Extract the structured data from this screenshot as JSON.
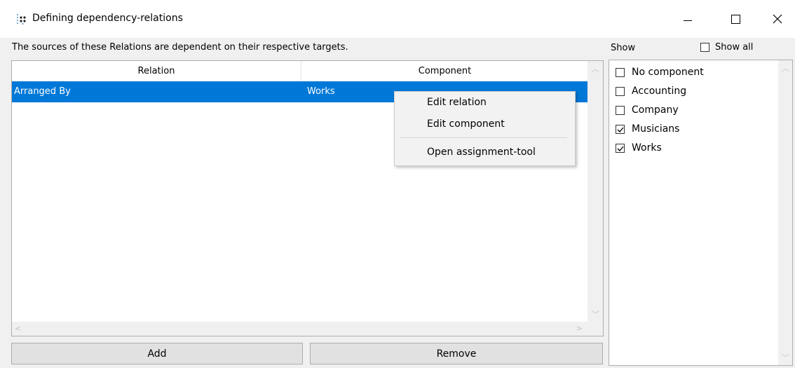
{
  "window": {
    "title": "Defining dependency-relations",
    "app_icon": "dots-grid-icon",
    "controls": [
      "minimize-icon",
      "maximize-icon",
      "close-icon"
    ]
  },
  "description": "The sources of these Relations are dependent on their respective targets.",
  "filter": {
    "show_label": "Show",
    "show_all_label": "Show all",
    "show_all_checked": false,
    "items": [
      {
        "label": "No component",
        "checked": false
      },
      {
        "label": "Accounting",
        "checked": false
      },
      {
        "label": "Company",
        "checked": false
      },
      {
        "label": "Musicians",
        "checked": true
      },
      {
        "label": "Works",
        "checked": true
      }
    ]
  },
  "table": {
    "columns": [
      "Relation",
      "Component"
    ],
    "rows": [
      {
        "relation": "Arranged By",
        "component": "Works",
        "selected": true
      }
    ]
  },
  "context_menu": {
    "items": [
      "Edit relation",
      "Edit component",
      "Open assignment-tool"
    ]
  },
  "buttons": {
    "add": "Add",
    "remove": "Remove"
  },
  "colors": {
    "selection": "#0078d7",
    "background": "#f0f0f0"
  }
}
